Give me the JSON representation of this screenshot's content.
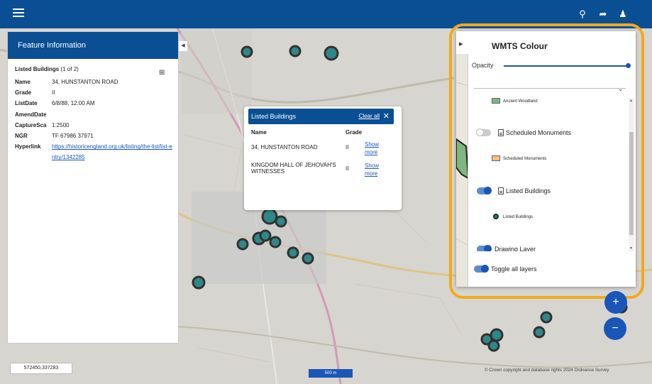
{
  "feature_panel": {
    "title": "Feature Information",
    "subtitle": "Listed Buildings",
    "count": "(1 of 2)",
    "export_icon": "export-icon",
    "fields": [
      {
        "label": "Name",
        "value": "34, HUNSTANTON ROAD"
      },
      {
        "label": "Grade",
        "value": "II"
      },
      {
        "label": "ListDate",
        "value": "6/8/88, 12:00 AM"
      },
      {
        "label": "AmendDate",
        "value": ""
      },
      {
        "label": "CaptureSca",
        "value": "1:2500"
      },
      {
        "label": "NGR",
        "value": "TF 67986 37971"
      },
      {
        "label": "Hyperlink",
        "value": "https://historicengland.org.uk/listing/the-list/list-entry/1342285"
      }
    ]
  },
  "map_footer": {
    "coords": "572450,337283",
    "scale": "500 m",
    "copyright": "© Crown copyright and database rights 2024 Ordnance Survey"
  },
  "popup": {
    "title": "Listed Buildings",
    "clear_all": "Clear all",
    "col_name": "Name",
    "col_grade": "Grade",
    "rows": [
      {
        "name": "34, HUNSTANTON ROAD",
        "grade": "II",
        "action_line1": "Show",
        "action_line2": "more"
      },
      {
        "name": "KINGDOM HALL OF JEHOVAH'S WITNESSES",
        "grade": "II",
        "action_line1": "Show",
        "action_line2": "more"
      }
    ]
  },
  "layer_panel": {
    "title": "WMTS Colour",
    "opacity_label": "Opacity",
    "opacity_value": 1.0,
    "legend_ancient_woodland": "Ancient Woodland",
    "layer_scheduled": "Scheduled Monuments",
    "legend_scheduled": "Scheduled Monuments",
    "layer_listed": "Listed Buildings",
    "legend_listed": "Listed Buildings",
    "layer_drawing": "Drawing Layer",
    "toggle_all": "Toggle all layers"
  },
  "colors": {
    "primary": "#0a4f94",
    "accent": "#1a56b8",
    "highlight": "#f2a91c",
    "ancient_woodland": "#7fb77e",
    "scheduled_monuments": "#f6c07a",
    "listed_building_point": "#1f8c8c"
  },
  "fab": {
    "zoom_in": "+",
    "zoom_out": "−"
  }
}
